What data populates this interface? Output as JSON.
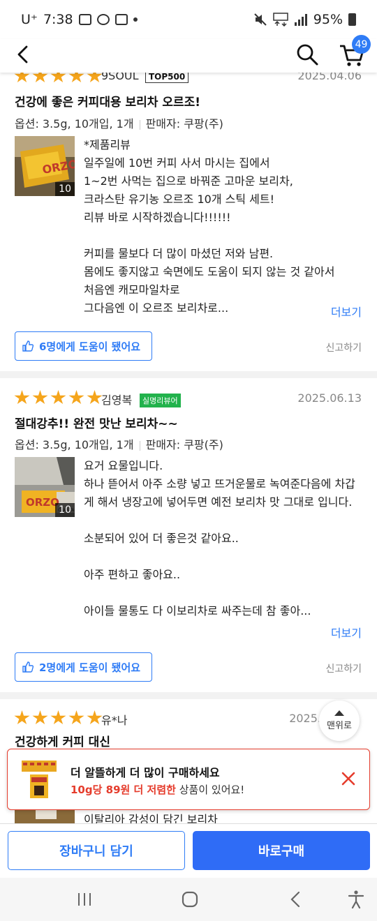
{
  "status_bar": {
    "carrier": "U⁺",
    "time": "7:38",
    "battery": "95%"
  },
  "header": {
    "cart_count": "49"
  },
  "reviews": [
    {
      "name": "9SOUL",
      "badge": "TOP500",
      "date": "2025.04.06",
      "title": "건강에 좋은 커피대용 보리차 오르조!",
      "option": "옵션: 3.5g, 10개입, 1개",
      "seller": "판매자: 쿠팡(주)",
      "photo_count": "10",
      "body": "*제품리뷰\n일주일에 10번 커피 사서 마시는 집에서\n1~2번 사먹는 집으로 바꿔준 고마운 보리차,\n크라스탄 유기농 오르조 10개 스틱 세트!\n리뷰 바로 시작하겠습니다!!!!!!\n\n커피를 물보다 더 많이 마셨던 저와 남편.\n몸에도 좋지않고 숙면에도 도움이 되지 않는 것 같아서\n처음엔 캐모마일차로\n그다음엔 이 오르조 보리차로...",
      "more": "더보기",
      "helpful": "6명에게 도움이 됐어요",
      "report": "신고하기"
    },
    {
      "name": "김영복",
      "badge": "실명리뷰어",
      "date": "2025.06.13",
      "title": "절대강추!! 완전 맛난 보리차~~",
      "option": "옵션: 3.5g, 10개입, 1개",
      "seller": "판매자: 쿠팡(주)",
      "photo_count": "10",
      "body": "요거 요물입니다.\n하나 뜯어서 아주 소량 넣고 뜨거운물로 녹여준다음에 차갑게 해서 냉장고에 넣어두면 예전 보리차 맛 그대로 입니다.\n\n소분되어 있어 더 좋은것 같아요..\n\n아주 편하고 좋아요..\n\n아이들 물통도 다 이보리차로 싸주는데 참 좋아...",
      "more": "더보기",
      "helpful": "2명에게 도움이 됐어요",
      "report": "신고하기"
    },
    {
      "name": "유*나",
      "date": "2025.",
      "title": "건강하게 커피 대신",
      "body": "이탈리아 감성이 담긴 보리차"
    }
  ],
  "to_top": "맨위로",
  "promo": {
    "line1": "더 알뜰하게 더 많이 구매하세요",
    "highlight": "10g당 89원 더 저렴한",
    "line2_rest": " 상품이 있어요!"
  },
  "actions": {
    "add_to_cart": "장바구니 담기",
    "buy_now": "바로구매"
  },
  "colors": {
    "accent": "#2f7cf6",
    "star": "#f5a51c",
    "promo_red": "#e53c2c",
    "badge_green": "#22b24c"
  }
}
